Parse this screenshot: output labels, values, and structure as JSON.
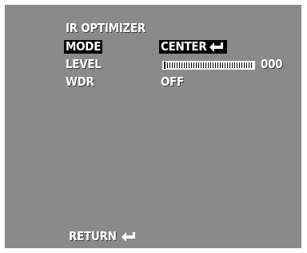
{
  "menu": {
    "title": "IR OPTIMIZER",
    "rows": {
      "mode": {
        "label": "MODE",
        "value": "CENTER",
        "selected": true
      },
      "level": {
        "label": "LEVEL",
        "value": "000",
        "bar_fill_fraction": 0.0
      },
      "wdr": {
        "label": "WDR",
        "value": "OFF"
      }
    },
    "return_label": "RETURN"
  },
  "icons": {
    "enter": "enter-arrow-icon"
  },
  "colors": {
    "screen_background": "#8a8a8a",
    "text": "#ffffff",
    "highlight": "#000000"
  }
}
